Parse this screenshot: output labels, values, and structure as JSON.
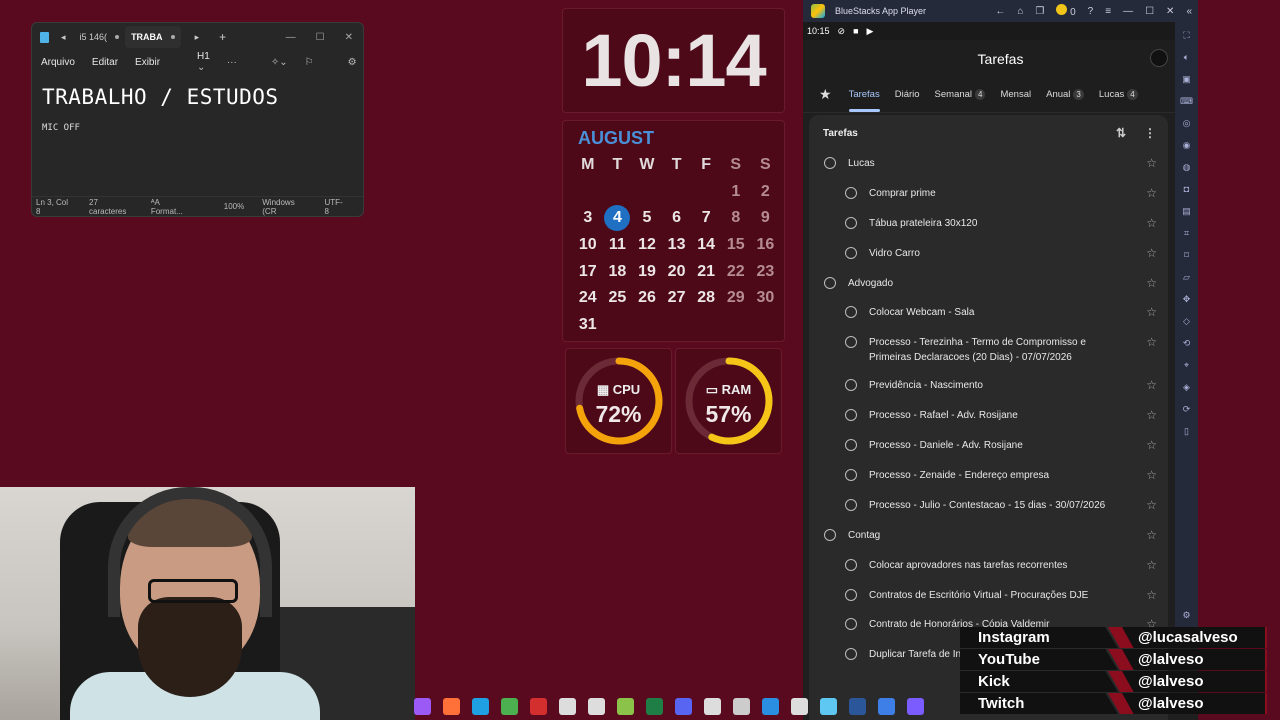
{
  "notepad": {
    "tabs": [
      "i5 146(",
      "TRABA"
    ],
    "menu": [
      "Arquivo",
      "Editar",
      "Exibir"
    ],
    "heading_level": "H1",
    "title_line": "TRABALHO / ESTUDOS",
    "second_line": "MIC OFF",
    "status": [
      "Ln 3, Col 8",
      "27 caracteres",
      "Format...",
      "100%",
      "Windows (CR",
      "UTF-8"
    ]
  },
  "clock": {
    "time": "10:14"
  },
  "calendar": {
    "month": "AUGUST",
    "weekdays": [
      "M",
      "T",
      "W",
      "T",
      "F",
      "S",
      "S"
    ],
    "weeks": [
      [
        "",
        "",
        "",
        "",
        "",
        "1",
        "2"
      ],
      [
        "3",
        "4",
        "5",
        "6",
        "7",
        "8",
        "9"
      ],
      [
        "10",
        "11",
        "12",
        "13",
        "14",
        "15",
        "16"
      ],
      [
        "17",
        "18",
        "19",
        "20",
        "21",
        "22",
        "23"
      ],
      [
        "24",
        "25",
        "26",
        "27",
        "28",
        "29",
        "30"
      ],
      [
        "31",
        "",
        "",
        "",
        "",
        "",
        ""
      ]
    ],
    "today": "4"
  },
  "gauges": {
    "cpu": {
      "label": "CPU",
      "value": "72%",
      "fraction": 0.72,
      "color": "#f5a30b"
    },
    "ram": {
      "label": "RAM",
      "value": "57%",
      "fraction": 0.57,
      "color": "#f5c518"
    }
  },
  "bluestacks": {
    "title": "BlueStacks App Player",
    "coins": "0",
    "status_time": "10:15",
    "app_title": "Tarefas",
    "tabs": [
      {
        "label": "Tarefas",
        "badge": ""
      },
      {
        "label": "Diário",
        "badge": ""
      },
      {
        "label": "Semanal",
        "badge": "4"
      },
      {
        "label": "Mensal",
        "badge": ""
      },
      {
        "label": "Anual",
        "badge": "3"
      },
      {
        "label": "Lucas",
        "badge": "4"
      }
    ],
    "panel_title": "Tarefas",
    "tasks": [
      {
        "text": "Lucas",
        "level": 0
      },
      {
        "text": "Comprar prime",
        "level": 1
      },
      {
        "text": "Tábua prateleira 30x120",
        "level": 1
      },
      {
        "text": "Vidro Carro",
        "level": 1
      },
      {
        "text": "Advogado",
        "level": 0
      },
      {
        "text": "Colocar Webcam - Sala",
        "level": 1
      },
      {
        "text": "Processo - Terezinha - Termo de Compromisso e Primeiras Declaracoes (20 Dias) - 07/07/2026",
        "level": 1
      },
      {
        "text": "Previdência - Nascimento",
        "level": 1
      },
      {
        "text": "Processo - Rafael - Adv. Rosijane",
        "level": 1
      },
      {
        "text": "Processo - Daniele - Adv. Rosijane",
        "level": 1
      },
      {
        "text": "Processo - Zenaide - Endereço empresa",
        "level": 1
      },
      {
        "text": "Processo - Julio - Contestacao - 15 dias - 30/07/2026",
        "level": 1
      },
      {
        "text": "Contag",
        "level": 0
      },
      {
        "text": "Colocar aprovadores nas tarefas recorrentes",
        "level": 1
      },
      {
        "text": "Contratos de Escritório Virtual - Procurações DJE",
        "level": 1
      },
      {
        "text": "Contrato de Honorários - Cópia Valdemir",
        "level": 1
      },
      {
        "text": "Duplicar Tarefa de In... Empresas Felipe",
        "level": 1
      }
    ]
  },
  "socials": [
    {
      "network": "Instagram",
      "handle": "@lucasalveso"
    },
    {
      "network": "YouTube",
      "handle": "@lalveso"
    },
    {
      "network": "Kick",
      "handle": "@lalveso"
    },
    {
      "network": "Twitch",
      "handle": "@lalveso"
    }
  ],
  "taskbar_icons": [
    "taskbar-app-icon",
    "firefox-icon",
    "edge-icon",
    "chrome-icon",
    "opera-icon",
    "app-icon",
    "x-icon",
    "bluestacks-icon",
    "excel-icon",
    "discord-icon",
    "obs-icon",
    "app-icon",
    "vscode-icon",
    "app-icon",
    "notepad-icon",
    "word-icon",
    "app-icon",
    "app-icon"
  ],
  "taskbar_colors": [
    "#9b59f6",
    "#ff7139",
    "#1fa0e3",
    "#4caf50",
    "#d32f2f",
    "#ddd",
    "#ddd",
    "#8bc34a",
    "#1e7e45",
    "#5865f2",
    "#ddd",
    "#ccc",
    "#2a8fe0",
    "#ddd",
    "#5ec8f2",
    "#2b579a",
    "#3d7fe6",
    "#7b5cff"
  ]
}
